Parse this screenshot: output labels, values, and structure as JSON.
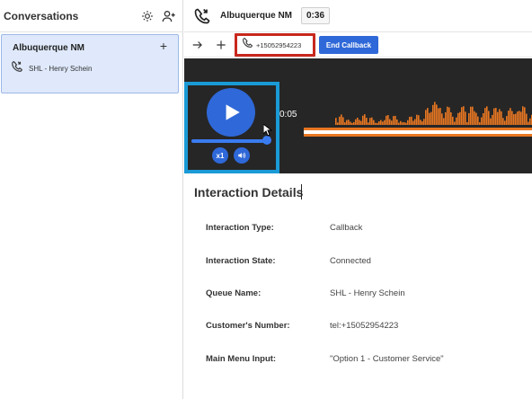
{
  "sidebar": {
    "title": "Conversations",
    "conversation": {
      "name": "Albuquerque NM",
      "queue": "SHL - Henry Schein"
    }
  },
  "header": {
    "title": "Albuquerque NM",
    "timer": "0:36"
  },
  "toolbar": {
    "phone_number": "+15052954223",
    "end_callback_label": "End Callback"
  },
  "player": {
    "elapsed": "0:05",
    "speed_label": "x1",
    "progress": 1.0
  },
  "details": {
    "title": "Interaction Details",
    "rows": [
      {
        "label": "Interaction Type:",
        "value": "Callback"
      },
      {
        "label": "Interaction State:",
        "value": "Connected"
      },
      {
        "label": "Queue Name:",
        "value": "SHL - Henry Schein"
      },
      {
        "label": "Customer's Number:",
        "value": "tel:+15052954223"
      },
      {
        "label": "Main Menu Input:",
        "value": "\"Option 1 - Customer Service\""
      }
    ]
  },
  "colors": {
    "accent": "#2f68d8",
    "highlight_red": "#c8281e",
    "highlight_blue": "#1a9ad6",
    "waveform": "#e87722"
  }
}
